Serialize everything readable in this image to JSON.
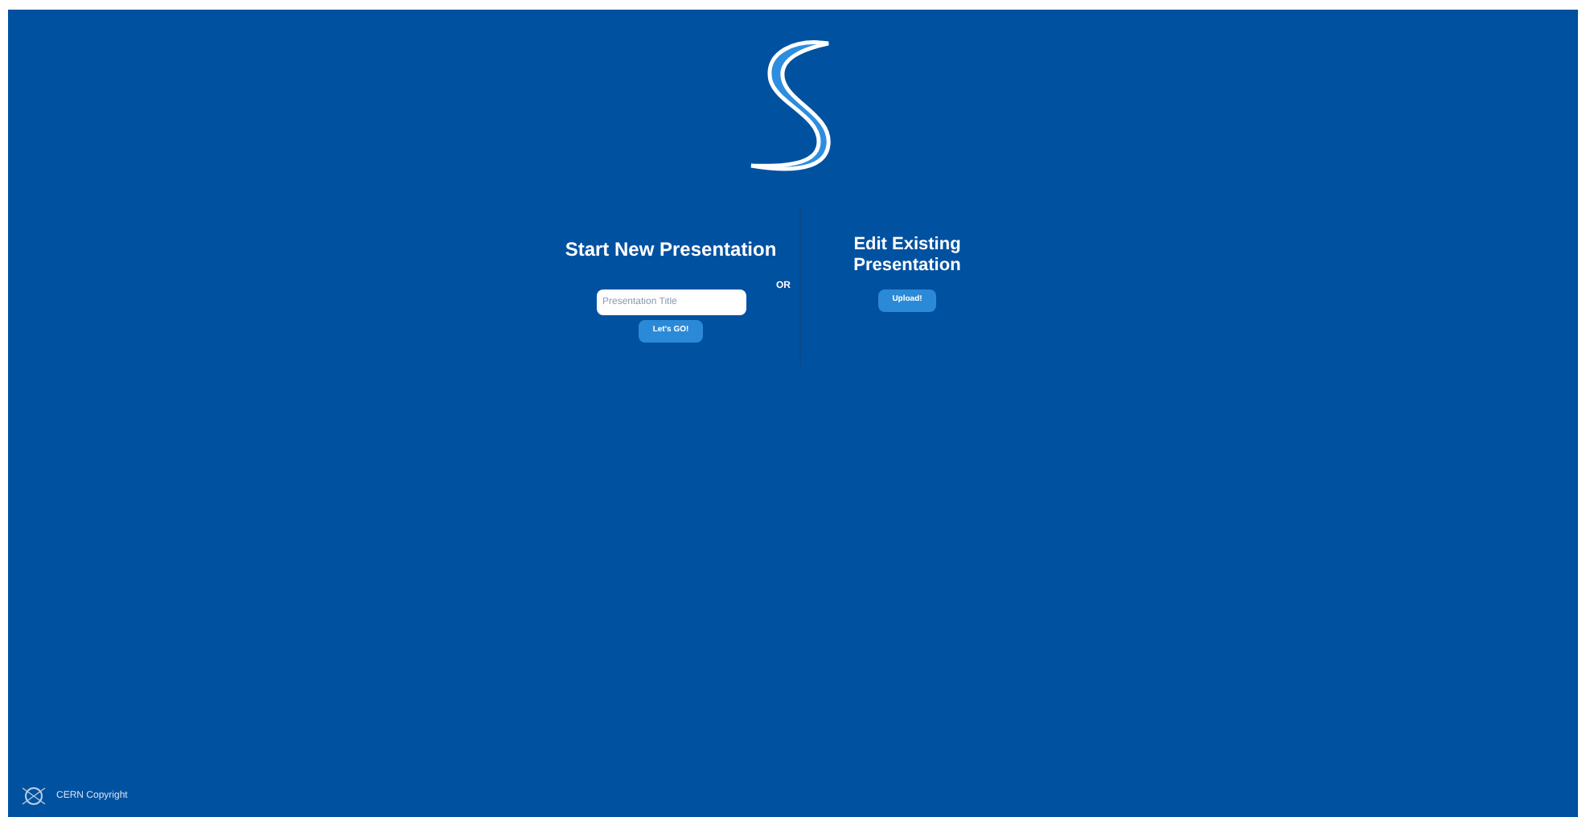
{
  "new_presentation": {
    "title": "Start New Presentation",
    "input": {
      "placeholder": "Presentation Title"
    },
    "button": "Let's GO!"
  },
  "separator": "OR",
  "existing_presentation": {
    "title": "Edit Existing Presentation",
    "button": "Upload!"
  },
  "footer": {
    "text": "CERN Copyright"
  }
}
